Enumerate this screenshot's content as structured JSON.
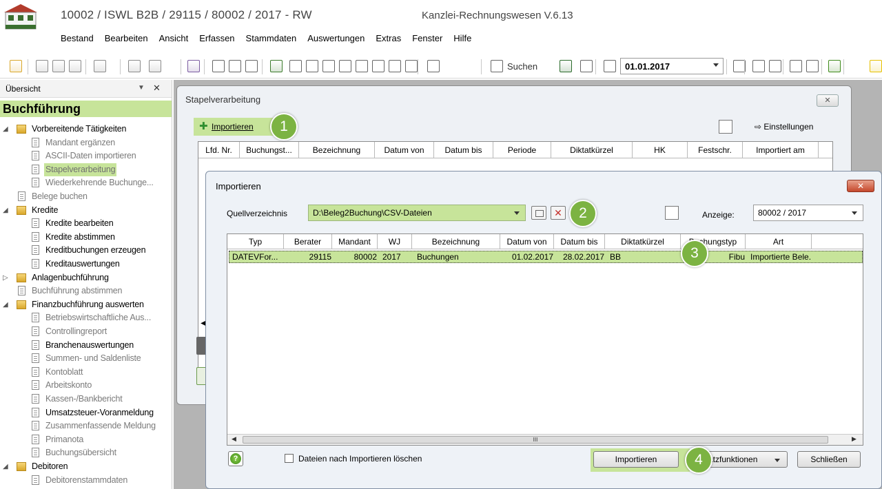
{
  "window": {
    "title": "10002 / ISWL B2B / 29115 / 80002 / 2017 - RW",
    "app_name": "Kanzlei-Rechnungswesen V.6.13"
  },
  "menu": [
    "Bestand",
    "Bearbeiten",
    "Ansicht",
    "Erfassen",
    "Stammdaten",
    "Auswertungen",
    "Extras",
    "Fenster",
    "Hilfe"
  ],
  "toolbar": {
    "search_label": "Suchen",
    "date_value": "01.01.2017"
  },
  "nav": {
    "header": "Übersicht",
    "section": "Buchführung",
    "items": [
      {
        "label": "Vorbereitende Tätigkeiten",
        "level": 0,
        "kind": "folder",
        "expanded": true,
        "disabled": false
      },
      {
        "label": "Mandant ergänzen",
        "level": 1,
        "kind": "doc",
        "disabled": true
      },
      {
        "label": "ASCII-Daten importieren",
        "level": 1,
        "kind": "doc",
        "disabled": true
      },
      {
        "label": "Stapelverarbeitung",
        "level": 1,
        "kind": "doc",
        "disabled": true,
        "selected": true
      },
      {
        "label": "Wiederkehrende Buchunge...",
        "level": 1,
        "kind": "doc",
        "disabled": true
      },
      {
        "label": "Belege buchen",
        "level": 0,
        "kind": "doc",
        "disabled": true
      },
      {
        "label": "Kredite",
        "level": 0,
        "kind": "folder",
        "expanded": true,
        "disabled": false
      },
      {
        "label": "Kredite bearbeiten",
        "level": 1,
        "kind": "doc",
        "disabled": false
      },
      {
        "label": "Kredite abstimmen",
        "level": 1,
        "kind": "doc",
        "disabled": false
      },
      {
        "label": "Kreditbuchungen erzeugen",
        "level": 1,
        "kind": "doc",
        "disabled": false
      },
      {
        "label": "Kreditauswertungen",
        "level": 1,
        "kind": "doc",
        "disabled": false
      },
      {
        "label": "Anlagenbuchführung",
        "level": 0,
        "kind": "folder",
        "expanded": false,
        "disabled": false
      },
      {
        "label": "Buchführung abstimmen",
        "level": 0,
        "kind": "doc",
        "disabled": true
      },
      {
        "label": "Finanzbuchführung auswerten",
        "level": 0,
        "kind": "folder",
        "expanded": true,
        "disabled": false
      },
      {
        "label": "Betriebswirtschaftliche Aus...",
        "level": 1,
        "kind": "doc",
        "disabled": true
      },
      {
        "label": "Controllingreport",
        "level": 1,
        "kind": "doc",
        "disabled": true
      },
      {
        "label": "Branchenauswertungen",
        "level": 1,
        "kind": "doc",
        "disabled": false
      },
      {
        "label": "Summen- und Saldenliste",
        "level": 1,
        "kind": "doc",
        "disabled": true
      },
      {
        "label": "Kontoblatt",
        "level": 1,
        "kind": "doc",
        "disabled": true
      },
      {
        "label": "Arbeitskonto",
        "level": 1,
        "kind": "doc",
        "disabled": true
      },
      {
        "label": "Kassen-/Bankbericht",
        "level": 1,
        "kind": "doc",
        "disabled": true
      },
      {
        "label": "Umsatzsteuer-Voranmeldung",
        "level": 1,
        "kind": "doc",
        "disabled": false
      },
      {
        "label": "Zusammenfassende Meldung",
        "level": 1,
        "kind": "doc",
        "disabled": true
      },
      {
        "label": "Primanota",
        "level": 1,
        "kind": "doc",
        "disabled": true
      },
      {
        "label": "Buchungsübersicht",
        "level": 1,
        "kind": "doc",
        "disabled": true
      },
      {
        "label": "Debitoren",
        "level": 0,
        "kind": "folder",
        "expanded": true,
        "disabled": false
      },
      {
        "label": "Debitorenstammdaten",
        "level": 1,
        "kind": "doc",
        "disabled": true
      }
    ]
  },
  "stapel": {
    "title": "Stapelverarbeitung",
    "import_label": "Importieren",
    "settings_label": "⇨ Einstellungen",
    "columns": [
      "Lfd. Nr.",
      "Buchungst...",
      "Bezeichnung",
      "Datum von",
      "Datum bis",
      "Periode",
      "Diktatkürzel",
      "HK",
      "Festschr.",
      "Importiert am"
    ]
  },
  "import_dialog": {
    "title": "Importieren",
    "source_label": "Quellverzeichnis",
    "source_path": "D:\\Beleg2Buchung\\CSV-Dateien",
    "display_label": "Anzeige:",
    "display_value": "80002 / 2017",
    "columns": [
      "Typ",
      "Berater",
      "Mandant",
      "WJ",
      "Bezeichnung",
      "Datum von",
      "Datum bis",
      "Diktatkürzel",
      "Buchungstyp",
      "Art"
    ],
    "rows": [
      [
        "DATEVFor...",
        "29115",
        "80002",
        "2017",
        "Buchungen",
        "01.02.2017",
        "28.02.2017",
        "BB",
        "Fibu",
        "Importierte Bele..."
      ]
    ],
    "scroll_label": "III",
    "delete_checkbox_label": "Dateien nach Importieren löschen",
    "import_button": "Importieren",
    "extra_button": "atzfunktionen",
    "close_button": "Schließen"
  },
  "callouts": [
    "1",
    "2",
    "3",
    "4"
  ],
  "colors": {
    "highlight": "#c7e49a",
    "callout": "#7cb342",
    "workspace": "#b4b4b4"
  }
}
